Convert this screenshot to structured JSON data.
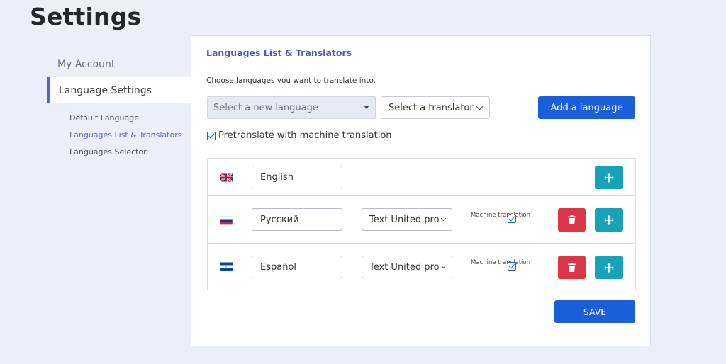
{
  "page": {
    "title": "Settings"
  },
  "sidebar": {
    "items": [
      {
        "label": "My Account"
      },
      {
        "label": "Language Settings"
      }
    ],
    "sub_items": [
      {
        "label": "Default Language"
      },
      {
        "label": "Languages List & Translators"
      },
      {
        "label": "Languages Selector"
      }
    ]
  },
  "panel": {
    "heading": "Languages List & Translators",
    "description": "Choose languages you want to translate into.",
    "language_select_placeholder": "Select a new language",
    "translator_select_placeholder": "Select a translator",
    "add_button": "Add a language",
    "pretranslate_label": "Pretranslate with machine translation",
    "pretranslate_checked": true,
    "save_button": "SAVE"
  },
  "languages": [
    {
      "name": "English",
      "flag": "uk-flag-icon",
      "translator": "",
      "machine_translation_label": "",
      "machine_translation": null
    },
    {
      "name": "Русский",
      "flag": "russia-flag-icon",
      "translator": "Text United professional",
      "machine_translation_label": "Machine translation",
      "machine_translation": true
    },
    {
      "name": "Español",
      "flag": "el-salvador-flag-icon",
      "translator": "Text United professional",
      "machine_translation_label": "Machine translation",
      "machine_translation": true
    }
  ],
  "colors": {
    "accent": "#5b5fd6",
    "primary_button": "#1a5ed9",
    "delete_button": "#dc3545",
    "move_button": "#17a2b8",
    "background": "#eceef8"
  },
  "icons": {
    "delete": "trash-icon",
    "move": "move-arrows-icon",
    "dropdown": "chevron-down-icon"
  }
}
